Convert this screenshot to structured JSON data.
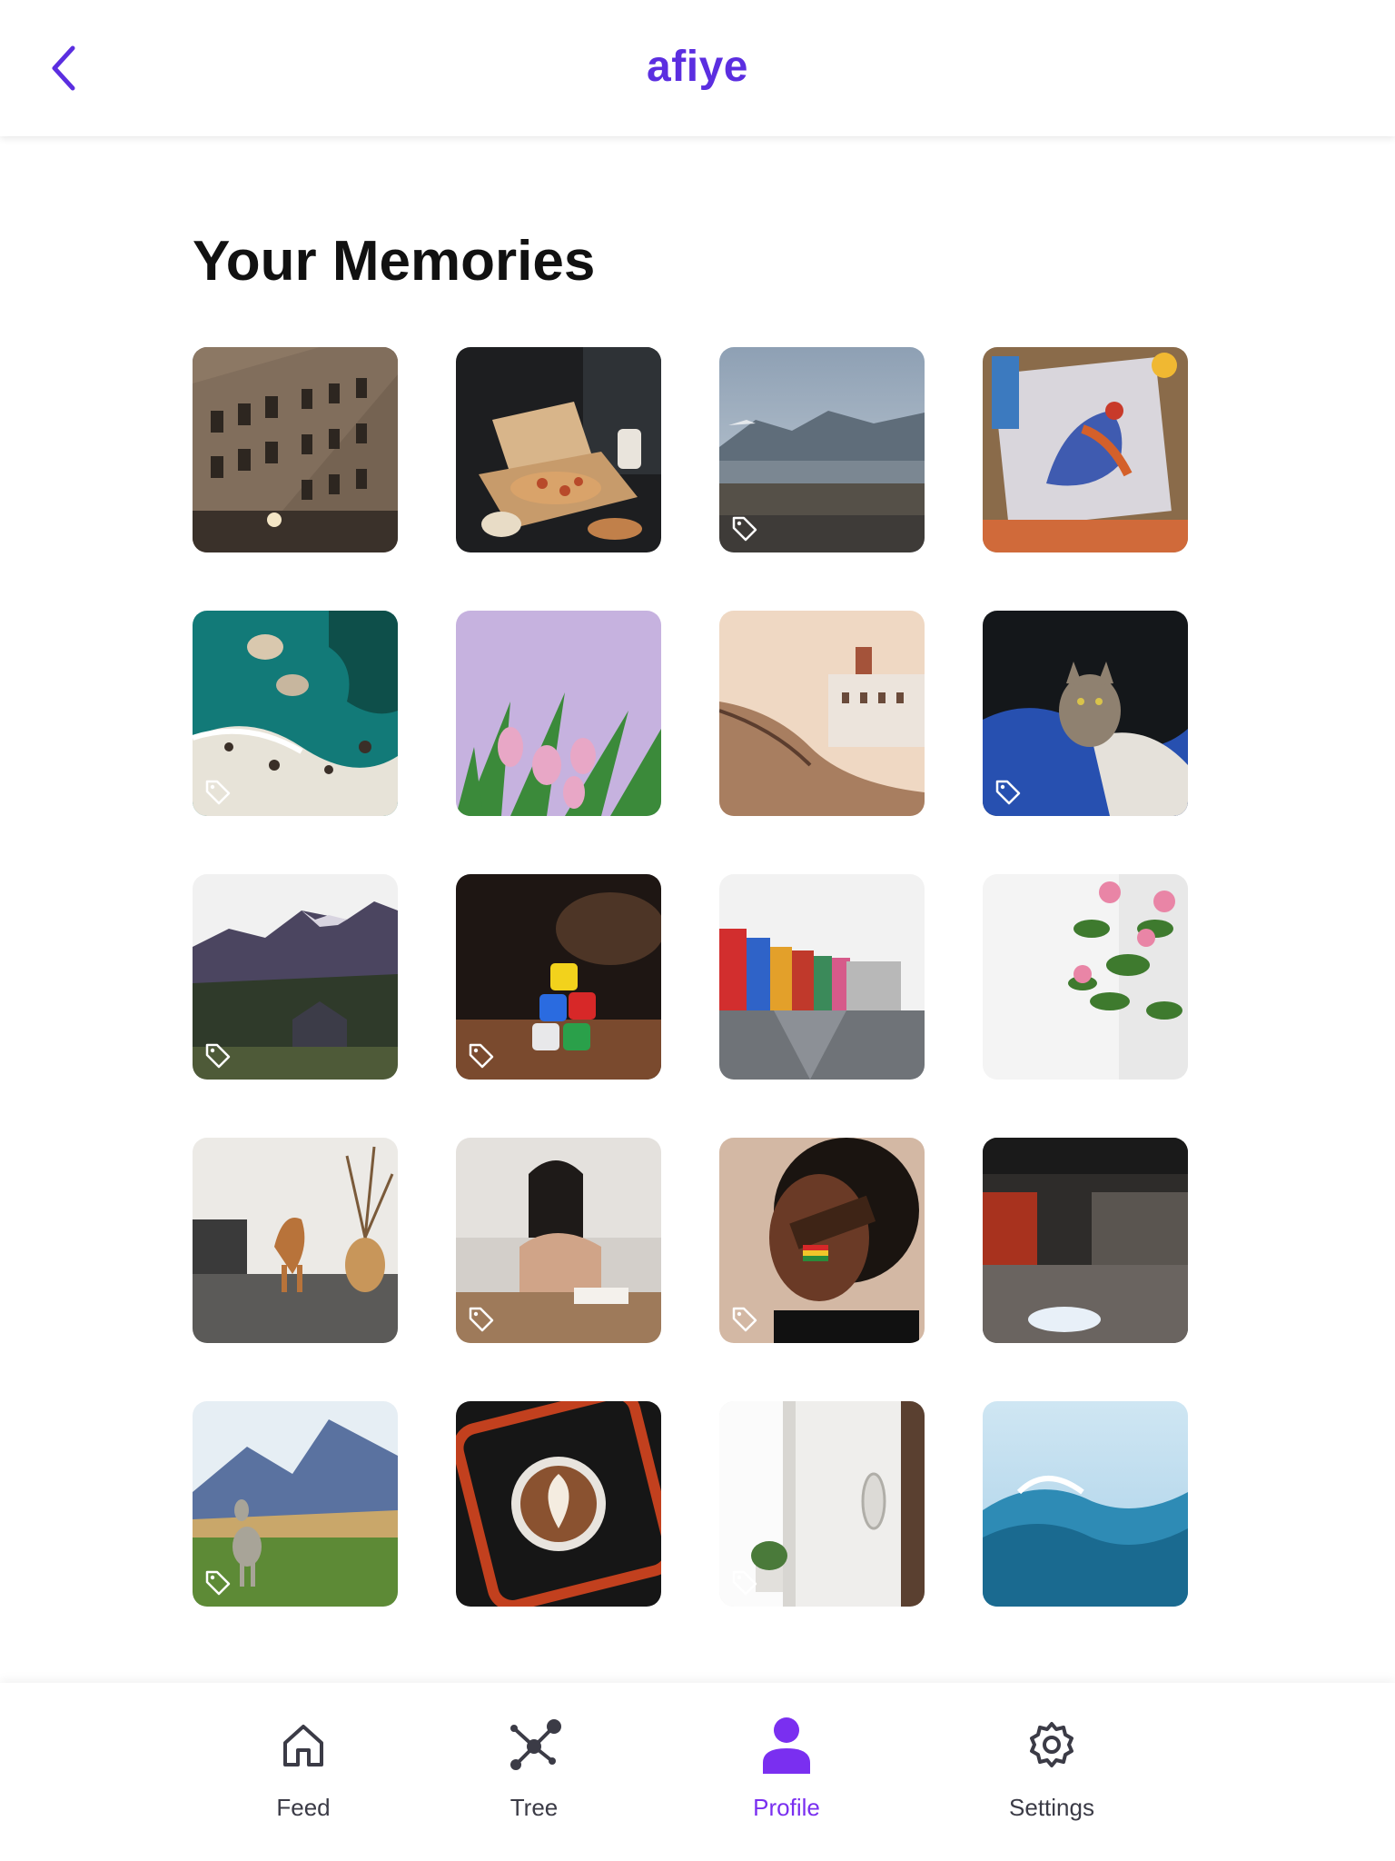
{
  "header": {
    "title": "afiye",
    "back_icon": "chevron-left-icon",
    "accent_color": "#5b2ee0"
  },
  "section": {
    "title": "Your Memories"
  },
  "memories": [
    {
      "subject": "building",
      "tagged": false
    },
    {
      "subject": "pizza",
      "tagged": false
    },
    {
      "subject": "lake-town",
      "tagged": true
    },
    {
      "subject": "rooster-painting",
      "tagged": false
    },
    {
      "subject": "ocean-rocks",
      "tagged": true
    },
    {
      "subject": "tulips",
      "tagged": false
    },
    {
      "subject": "river-town",
      "tagged": false
    },
    {
      "subject": "cat",
      "tagged": true
    },
    {
      "subject": "mountains",
      "tagged": true
    },
    {
      "subject": "dice",
      "tagged": true
    },
    {
      "subject": "canal-street",
      "tagged": false
    },
    {
      "subject": "pink-flowers",
      "tagged": false
    },
    {
      "subject": "horse-decor",
      "tagged": false
    },
    {
      "subject": "woman-reading",
      "tagged": true
    },
    {
      "subject": "face-flag",
      "tagged": true
    },
    {
      "subject": "studio-room",
      "tagged": false
    },
    {
      "subject": "dog-field",
      "tagged": true
    },
    {
      "subject": "latte",
      "tagged": false
    },
    {
      "subject": "interior-window",
      "tagged": true
    },
    {
      "subject": "ocean-wave",
      "tagged": false
    }
  ],
  "nav": {
    "items": [
      {
        "label": "Feed",
        "icon": "home-icon"
      },
      {
        "label": "Tree",
        "icon": "network-icon"
      },
      {
        "label": "Profile",
        "icon": "user-icon",
        "active": true
      },
      {
        "label": "Settings",
        "icon": "gear-icon"
      }
    ],
    "active_color": "#7a2ff0",
    "inactive_color": "#3b3b46"
  }
}
